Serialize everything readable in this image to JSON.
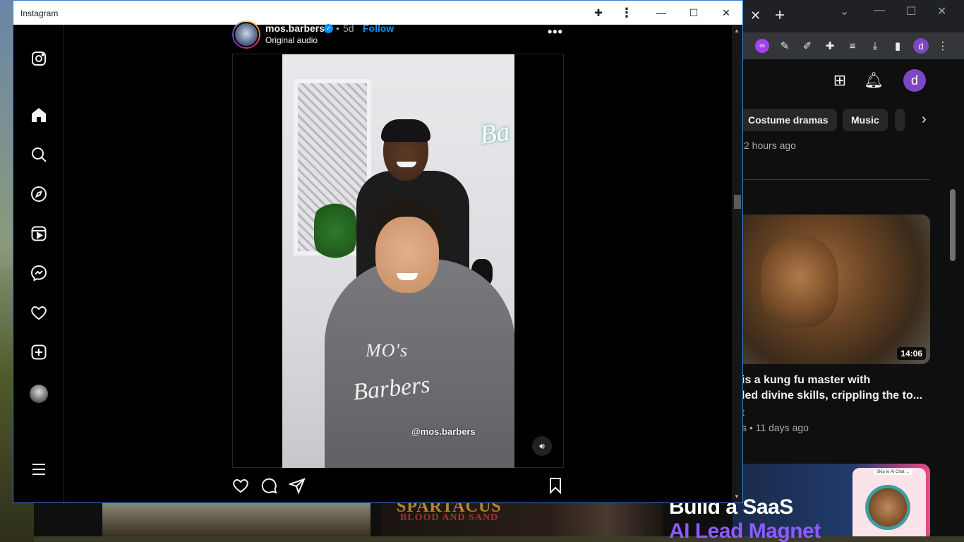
{
  "instagram_window": {
    "title": "Instagram",
    "post": {
      "username": "mos.barbers",
      "separator": "•",
      "time": "5d",
      "follow_label": "Follow",
      "audio": "Original audio",
      "more": "•••",
      "video_watermark": "@mos.barbers",
      "cape_text_1": "MO's",
      "cape_text_2": "Barbers",
      "wall_sign_text": "Ba"
    },
    "nav_icons": [
      "instagram-logo-icon",
      "home-icon",
      "search-icon",
      "explore-icon",
      "reels-icon",
      "messenger-icon",
      "heart-icon",
      "create-icon",
      "profile-avatar",
      "menu-icon"
    ]
  },
  "browser": {
    "tab_close": "✕",
    "new_tab": "+",
    "profile_initial": "d"
  },
  "youtube": {
    "avatar_initial": "d",
    "chips": [
      "Costume dramas",
      "Music"
    ],
    "first_meta": "2 hours ago",
    "video": {
      "duration": "14:06",
      "title_line1": "is a kung fu master with",
      "title_line2": "led divine skills, crippling the to...",
      "channel_fragment": "t",
      "meta": "s • 11 days ago"
    },
    "ad": {
      "line1": "Build a SaaS",
      "line2": "AI Lead Magnet",
      "pill": "Skip to AI Chat →"
    }
  },
  "background_strip": {
    "poster_title": "SPARTACUS",
    "poster_subtitle": "BLOOD AND SAND"
  }
}
